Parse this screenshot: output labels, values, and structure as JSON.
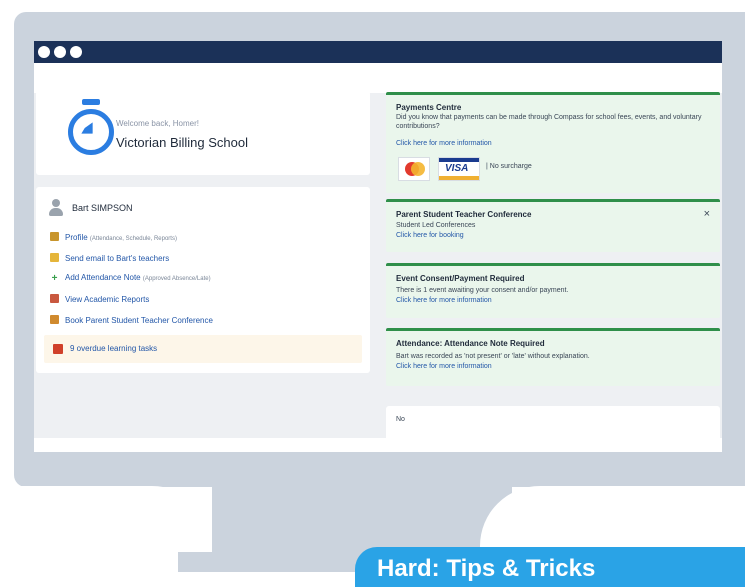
{
  "school_card": {
    "welcome": "Welcome back, Homer!",
    "school_name": "Victorian Billing School"
  },
  "student": {
    "name": "Bart SIMPSON",
    "links": [
      {
        "label": "Profile",
        "sub": "(Attendance, Schedule, Reports)",
        "icon": "profile-icon",
        "color": "#c8952c"
      },
      {
        "label": "Send email to Bart's teachers",
        "sub": "",
        "icon": "email-icon",
        "color": "#e5b53a"
      },
      {
        "label": "Add Attendance Note",
        "sub": "(Approved Absence/Late)",
        "icon": "plus-icon",
        "color": "#3aa04e"
      },
      {
        "label": "View Academic Reports",
        "sub": "",
        "icon": "report-icon",
        "color": "#c9583f"
      },
      {
        "label": "Book Parent Student Teacher Conference",
        "sub": "",
        "icon": "conference-icon",
        "color": "#d08a2e"
      }
    ],
    "overdue": "9 overdue learning tasks"
  },
  "notifications": {
    "payments": {
      "title": "Payments Centre",
      "text": "Did you know that payments can be made through Compass for school fees, events, and voluntary contributions?",
      "link": "Click here for more information",
      "card_brand": "VISA",
      "surcharge": "| No surcharge"
    },
    "conference": {
      "title": "Parent Student Teacher Conference",
      "text": "Student Led Conferences",
      "link": "Click here for booking",
      "close": "×"
    },
    "event": {
      "title": "Event Consent/Payment Required",
      "text": "There is 1 event awaiting your consent and/or payment.",
      "link": "Click here for more information"
    },
    "attendance": {
      "title": "Attendance: Attendance Note Required",
      "text": "Bart was recorded as 'not present' or 'late' without explanation.",
      "link": "Click here for more information"
    },
    "bottom_label": "No"
  },
  "banner": {
    "text": "Hard: Tips & Tricks"
  },
  "colors": {
    "browser_bar": "#1b3158",
    "accent_blue": "#2b7de1",
    "notif_green": "#2f8f4a",
    "banner": "#2aa3e6"
  }
}
